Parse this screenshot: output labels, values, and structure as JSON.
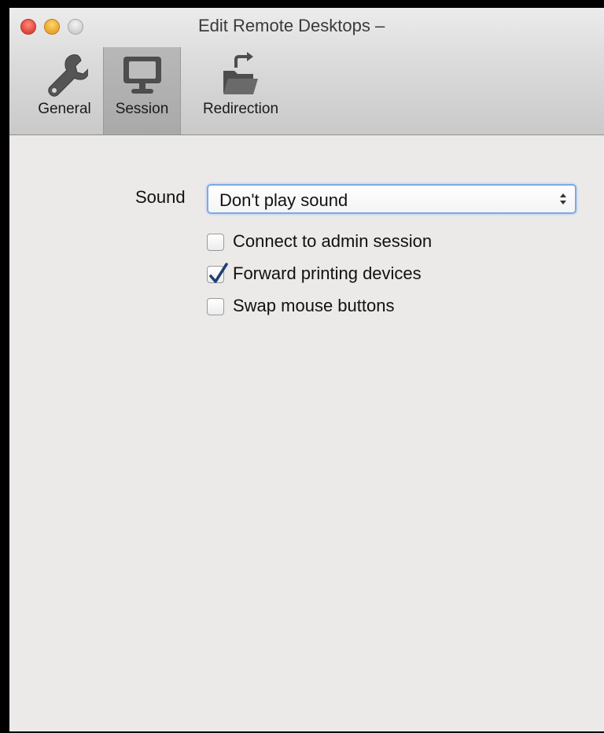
{
  "window": {
    "title": "Edit Remote Desktops –"
  },
  "toolbar": {
    "tabs": [
      {
        "label": "General",
        "icon": "wrench-icon",
        "selected": false
      },
      {
        "label": "Session",
        "icon": "monitor-icon",
        "selected": true
      },
      {
        "label": "Redirection",
        "icon": "folder-redirect-icon",
        "selected": false
      }
    ]
  },
  "session": {
    "sound_label": "Sound",
    "sound_value": "Don't play sound",
    "options": [
      {
        "label": "Connect to admin session",
        "checked": false
      },
      {
        "label": "Forward printing devices",
        "checked": true
      },
      {
        "label": "Swap mouse buttons",
        "checked": false
      }
    ]
  },
  "colors": {
    "select_focus": "#7fa9e3",
    "checkmark": "#1f3f73",
    "close": "#e0443a",
    "minimize": "#e8a52a"
  }
}
